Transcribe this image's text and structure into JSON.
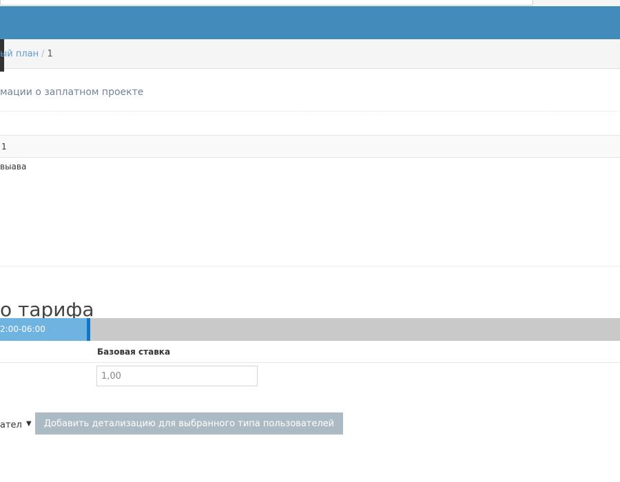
{
  "breadcrumb": {
    "parent_label": "ый план",
    "separator": "/",
    "current_label": "1"
  },
  "subtitle": "мации о заплатном проекте",
  "row": {
    "value": "1"
  },
  "description": "выава",
  "tariff": {
    "heading": "о тарифа",
    "active_tab": "2:00-06:00",
    "column_header": "Базовая ставка",
    "rate_value": "1,00"
  },
  "user_type_select": {
    "selected": "ател",
    "arrow_icon": "triangle-down-icon"
  },
  "add_button_label": "Добавить детализацию для выбранного типа пользователей",
  "colors": {
    "navbar": "#428bba",
    "tab_active": "#6fb3e0",
    "tab_accent": "#0f77c6",
    "link": "#5b9bd1",
    "button": "#abbac3"
  }
}
